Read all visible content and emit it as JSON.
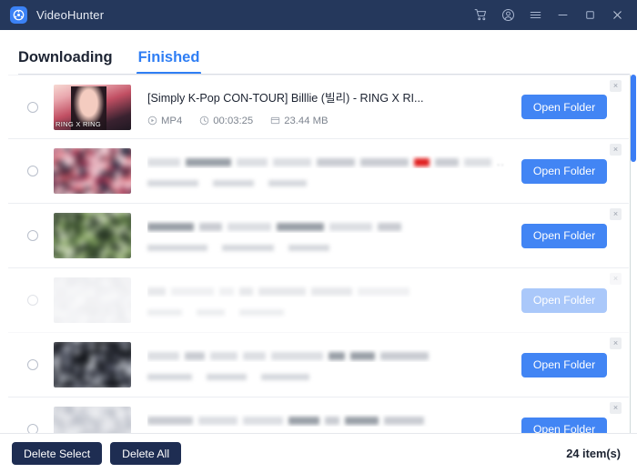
{
  "window": {
    "app_title": "VideoHunter",
    "logo_icon": "videohunter-logo-icon",
    "controls": [
      {
        "name": "cart-icon",
        "glyph": "cart"
      },
      {
        "name": "account-icon",
        "glyph": "account"
      },
      {
        "name": "menu-icon",
        "glyph": "menu"
      },
      {
        "name": "minimize-icon",
        "glyph": "minimize"
      },
      {
        "name": "maximize-icon",
        "glyph": "maximize"
      },
      {
        "name": "close-icon",
        "glyph": "close"
      }
    ],
    "titlebar_color": "#25385c"
  },
  "tabs": [
    {
      "label": "Downloading",
      "active": false
    },
    {
      "label": "Finished",
      "active": true
    }
  ],
  "accent_color": "#4285f4",
  "list": {
    "open_folder_label": "Open Folder",
    "close_label": "×",
    "items": [
      {
        "selected": false,
        "blurred": false,
        "title": "[Simply K-Pop CON-TOUR] Billlie (빌리) - RING X RI...",
        "format": "MP4",
        "duration": "00:03:25",
        "size": "23.44 MB",
        "thumbnail_caption": "RING X RING"
      },
      {
        "selected": false,
        "blurred": true,
        "title": "",
        "format": "",
        "duration": "",
        "size": "",
        "thumbnail_caption": ""
      },
      {
        "selected": false,
        "blurred": true,
        "title": "",
        "format": "",
        "duration": "",
        "size": "",
        "thumbnail_caption": ""
      },
      {
        "selected": false,
        "blurred": true,
        "title": "",
        "format": "",
        "duration": "",
        "size": "",
        "thumbnail_caption": ""
      },
      {
        "selected": false,
        "blurred": true,
        "title": "",
        "format": "",
        "duration": "",
        "size": "",
        "thumbnail_caption": ""
      },
      {
        "selected": false,
        "blurred": true,
        "title": "",
        "format": "",
        "duration": "",
        "size": "",
        "thumbnail_caption": ""
      }
    ]
  },
  "footer": {
    "delete_select_label": "Delete Select",
    "delete_all_label": "Delete All",
    "item_count": "24 item(s)"
  }
}
